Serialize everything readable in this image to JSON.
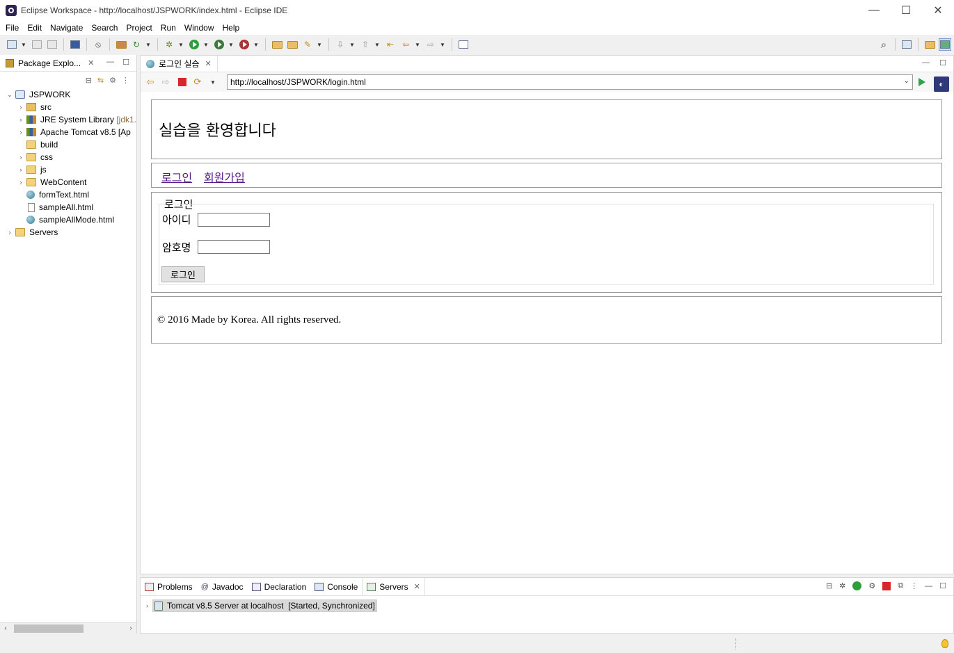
{
  "window": {
    "title": "Eclipse Workspace - http://localhost/JSPWORK/index.html - Eclipse IDE",
    "controls": {
      "minimize": "—",
      "maximize": "☐",
      "close": "✕"
    }
  },
  "menubar": {
    "items": [
      "File",
      "Edit",
      "Navigate",
      "Search",
      "Project",
      "Run",
      "Window",
      "Help"
    ]
  },
  "package_explorer": {
    "tab_label": "Package Explo...",
    "tree": [
      {
        "label": "JSPWORK",
        "detail": "",
        "indent": 0,
        "twisty": "⌄",
        "icon": "project-icon"
      },
      {
        "label": "src",
        "detail": "",
        "indent": 1,
        "twisty": "›",
        "icon": "source-folder-icon"
      },
      {
        "label": "JRE System Library ",
        "detail": "[jdk1.",
        "indent": 1,
        "twisty": "›",
        "icon": "library-icon"
      },
      {
        "label": "Apache Tomcat v8.5 [Ap",
        "detail": "",
        "indent": 1,
        "twisty": "›",
        "icon": "library-icon"
      },
      {
        "label": "build",
        "detail": "",
        "indent": 1,
        "twisty": "",
        "icon": "folder-icon"
      },
      {
        "label": "css",
        "detail": "",
        "indent": 1,
        "twisty": "›",
        "icon": "folder-icon"
      },
      {
        "label": "js",
        "detail": "",
        "indent": 1,
        "twisty": "›",
        "icon": "folder-icon"
      },
      {
        "label": "WebContent",
        "detail": "",
        "indent": 1,
        "twisty": "›",
        "icon": "folder-icon"
      },
      {
        "label": "formText.html",
        "detail": "",
        "indent": 1,
        "twisty": "",
        "icon": "globe-icon"
      },
      {
        "label": "sampleAll.html",
        "detail": "",
        "indent": 1,
        "twisty": "",
        "icon": "file-icon"
      },
      {
        "label": "sampleAllMode.html",
        "detail": "",
        "indent": 1,
        "twisty": "",
        "icon": "globe-icon"
      },
      {
        "label": "Servers",
        "detail": "",
        "indent": 0,
        "twisty": "›",
        "icon": "folder-icon"
      }
    ]
  },
  "editor": {
    "tab_label": "로그인 실습",
    "url": "http://localhost/JSPWORK/login.html"
  },
  "webpage": {
    "header_title": "실습을 환영합니다",
    "nav": {
      "login": "로그인",
      "signup": "회원가입"
    },
    "form": {
      "legend": "로그인",
      "id_label": "아이디",
      "id_value": "",
      "password_label": "암호명",
      "password_value": "",
      "submit_label": "로그인"
    },
    "footer": "© 2016 Made by Korea. All rights reserved."
  },
  "bottom_panel": {
    "tabs": [
      "Problems",
      "Javadoc",
      "Declaration",
      "Console",
      "Servers"
    ],
    "active_tab": "Servers",
    "server_entry": "Tomcat v8.5 Server at localhost  [Started, Synchronized]"
  }
}
